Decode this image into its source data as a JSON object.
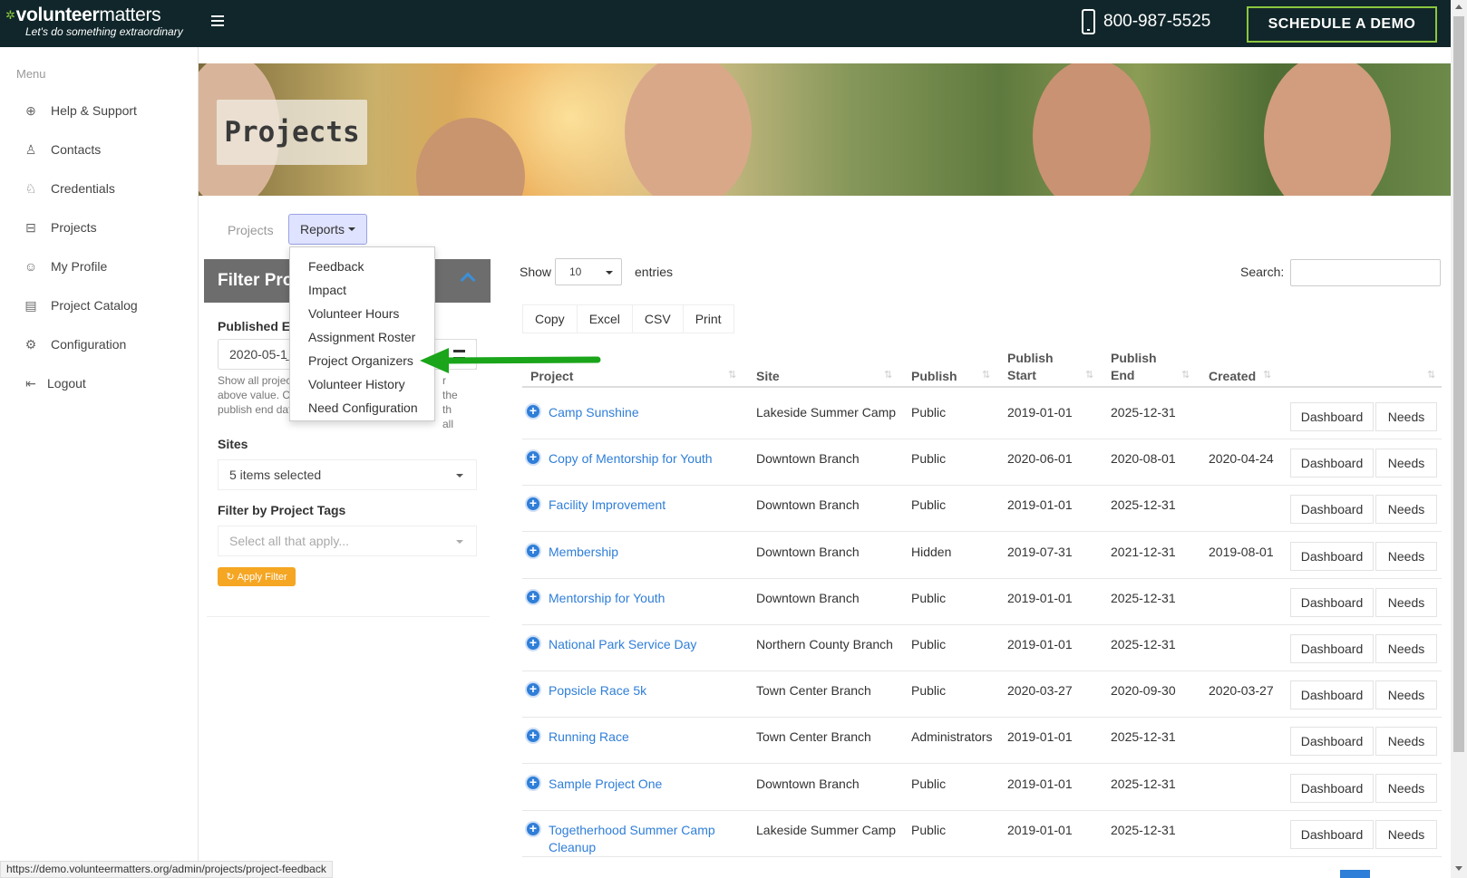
{
  "header": {
    "brand_bold": "volunteer",
    "brand_thin": "matters",
    "tagline": "Let's do something extraordinary",
    "phone": "800-987-5525",
    "demo_button": "SCHEDULE A DEMO"
  },
  "sidebar": {
    "title": "Menu",
    "items": [
      {
        "label": "Help & Support",
        "icon": "lifebuoy-icon"
      },
      {
        "label": "Contacts",
        "icon": "contacts-icon"
      },
      {
        "label": "Credentials",
        "icon": "badge-icon"
      },
      {
        "label": "Projects",
        "icon": "briefcase-icon"
      },
      {
        "label": "My Profile",
        "icon": "smiley-icon"
      },
      {
        "label": "Project Catalog",
        "icon": "book-icon"
      },
      {
        "label": "Configuration",
        "icon": "gear-icon"
      },
      {
        "label": "Logout",
        "icon": "logout-icon"
      }
    ]
  },
  "hero": {
    "title": "Projects"
  },
  "tabs": {
    "projects": "Projects",
    "reports": "Reports"
  },
  "reports_menu": [
    "Feedback",
    "Impact",
    "Volunteer Hours",
    "Assignment Roster",
    "Project Organizers",
    "Volunteer History",
    "Need Configuration"
  ],
  "filter": {
    "heading": "Filter Pro",
    "published_label": "Published E",
    "published_value": "2020-05-1̱",
    "help_text_left": "Show all projec\nabove value. C\npublish end dat",
    "help_text_right": "r the\nth all",
    "sites_label": "Sites",
    "sites_value": "5 items selected",
    "tags_label": "Filter by Project Tags",
    "tags_placeholder": "Select all that apply...",
    "apply_button": "Apply Filter"
  },
  "controls": {
    "show": "Show",
    "entries_value": "10",
    "entries": "entries",
    "search": "Search:",
    "export": [
      "Copy",
      "Excel",
      "CSV",
      "Print"
    ]
  },
  "table": {
    "columns": {
      "project": "Project",
      "site": "Site",
      "publish": "Publish",
      "publish_start_1": "Publish",
      "publish_start_2": "Start",
      "publish_end_1": "Publish",
      "publish_end_2": "End",
      "created": "Created"
    },
    "dashboard_label": "Dashboard",
    "needs_label": "Needs",
    "rows": [
      {
        "project": "Camp Sunshine",
        "site": "Lakeside Summer Camp",
        "publish": "Public",
        "start": "2019-01-01",
        "end": "2025-12-31",
        "created": ""
      },
      {
        "project": "Copy of Mentorship for Youth",
        "site": "Downtown Branch",
        "publish": "Public",
        "start": "2020-06-01",
        "end": "2020-08-01",
        "created": "2020-04-24"
      },
      {
        "project": "Facility Improvement",
        "site": "Downtown Branch",
        "publish": "Public",
        "start": "2019-01-01",
        "end": "2025-12-31",
        "created": ""
      },
      {
        "project": "Membership",
        "site": "Downtown Branch",
        "publish": "Hidden",
        "start": "2019-07-31",
        "end": "2021-12-31",
        "created": "2019-08-01"
      },
      {
        "project": "Mentorship for Youth",
        "site": "Downtown Branch",
        "publish": "Public",
        "start": "2019-01-01",
        "end": "2025-12-31",
        "created": ""
      },
      {
        "project": "National Park Service Day",
        "site": "Northern County Branch",
        "publish": "Public",
        "start": "2019-01-01",
        "end": "2025-12-31",
        "created": ""
      },
      {
        "project": "Popsicle Race 5k",
        "site": "Town Center Branch",
        "publish": "Public",
        "start": "2020-03-27",
        "end": "2020-09-30",
        "created": "2020-03-27"
      },
      {
        "project": "Running Race",
        "site": "Town Center Branch",
        "publish": "Administrators",
        "start": "2019-01-01",
        "end": "2025-12-31",
        "created": ""
      },
      {
        "project": "Sample Project One",
        "site": "Downtown Branch",
        "publish": "Public",
        "start": "2019-01-01",
        "end": "2025-12-31",
        "created": ""
      },
      {
        "project": "Togetherhood Summer Camp\nCleanup",
        "site": "Lakeside Summer Camp",
        "publish": "Public",
        "start": "2019-01-01",
        "end": "2025-12-31",
        "created": ""
      }
    ]
  },
  "status_url": "https://demo.volunteermatters.org/admin/projects/project-feedback",
  "colors": {
    "topbar": "#10262a",
    "accent_green": "#8cc63f",
    "link_blue": "#2f7ed8",
    "apply_orange": "#f5a623"
  }
}
